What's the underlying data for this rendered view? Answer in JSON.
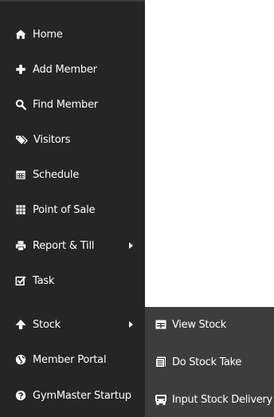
{
  "sidebar": {
    "items": [
      {
        "label": "Home",
        "icon": "home-icon"
      },
      {
        "label": "Add Member",
        "icon": "plus-icon"
      },
      {
        "label": "Find Member",
        "icon": "search-icon"
      },
      {
        "label": "Visitors",
        "icon": "tags-icon"
      },
      {
        "label": "Schedule",
        "icon": "calendar-icon"
      },
      {
        "label": "Point of Sale",
        "icon": "grid-icon"
      },
      {
        "label": "Report & Till",
        "icon": "printer-icon",
        "has_submenu": true
      },
      {
        "label": "Task",
        "icon": "checkbox-icon"
      },
      {
        "label": "Stock",
        "icon": "up-arrow-icon",
        "has_submenu": true
      },
      {
        "label": "Member Portal",
        "icon": "globe-icon"
      },
      {
        "label": "GymMaster Startup",
        "icon": "question-circle-icon"
      }
    ]
  },
  "submenu": {
    "items": [
      {
        "label": "View Stock",
        "icon": "stock-list-icon"
      },
      {
        "label": "Do Stock Take",
        "icon": "clipboard-icon"
      },
      {
        "label": "Input Stock Delivery",
        "icon": "truck-icon"
      }
    ]
  },
  "colors": {
    "sidebar_bg": "#252525",
    "submenu_bg": "#3d3d3d",
    "text": "#ffffff"
  }
}
